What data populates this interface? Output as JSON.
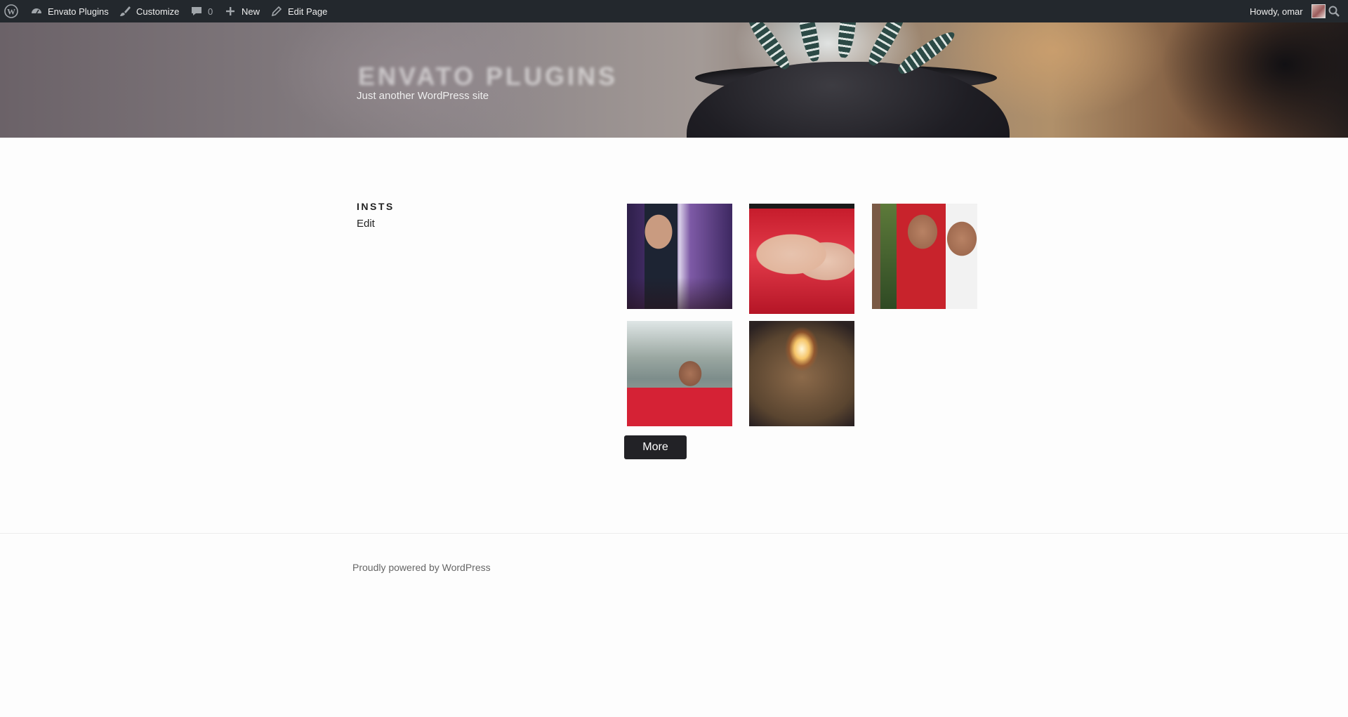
{
  "admin_bar": {
    "site_name": "Envato Plugins",
    "customize": "Customize",
    "comments_count": "0",
    "new": "New",
    "edit_page": "Edit Page",
    "howdy": "Howdy, omar"
  },
  "header": {
    "site_title": "Envato Plugins",
    "site_description": "Just another WordPress site"
  },
  "page": {
    "title": "INSTS",
    "edit_link": "Edit"
  },
  "gallery": {
    "more_button": "More"
  },
  "footer": {
    "powered_by": "Proudly powered by WordPress"
  },
  "colors": {
    "admin_bar_bg": "#23282d",
    "button_bg": "#222226"
  }
}
